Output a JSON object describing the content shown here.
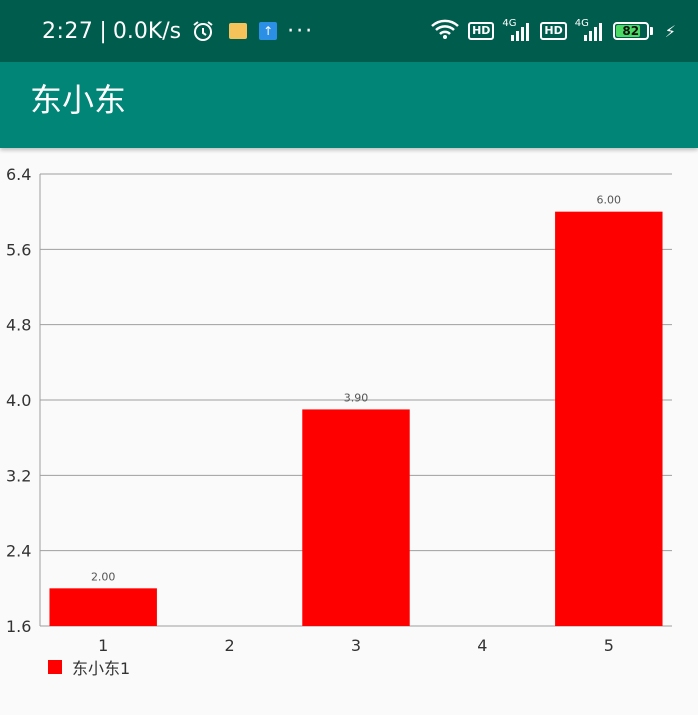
{
  "status_bar": {
    "time": "2:27",
    "separator": "|",
    "net_speed": "0.0K/s",
    "more": "···",
    "hd1": "HD",
    "net1": "4G",
    "hd2": "HD",
    "net2": "4G",
    "battery_level": "82",
    "battery_fraction": 0.82,
    "icons": [
      "alarm-icon",
      "notes-icon",
      "upload-icon",
      "wifi-icon",
      "signal-icon",
      "battery-icon",
      "charging-icon"
    ]
  },
  "app_bar": {
    "title": "东小东"
  },
  "colors": {
    "status_bar": "#005c4d",
    "app_bar": "#008577",
    "bar": "#ff0000",
    "background": "#fafafa"
  },
  "chart_data": {
    "type": "bar",
    "categories": [
      "1",
      "2",
      "3",
      "4",
      "5"
    ],
    "series": [
      {
        "name": "东小东1",
        "values": [
          2.0,
          null,
          3.9,
          null,
          6.0
        ],
        "labels": [
          "2.00",
          "",
          "3.90",
          "",
          "6.00"
        ],
        "color": "#ff0000"
      }
    ],
    "yticks": [
      "1.6",
      "2.4",
      "3.2",
      "4.0",
      "4.8",
      "5.6",
      "6.4"
    ],
    "ylim": [
      1.6,
      6.4
    ],
    "grid": true,
    "legend": "bottom-left"
  }
}
